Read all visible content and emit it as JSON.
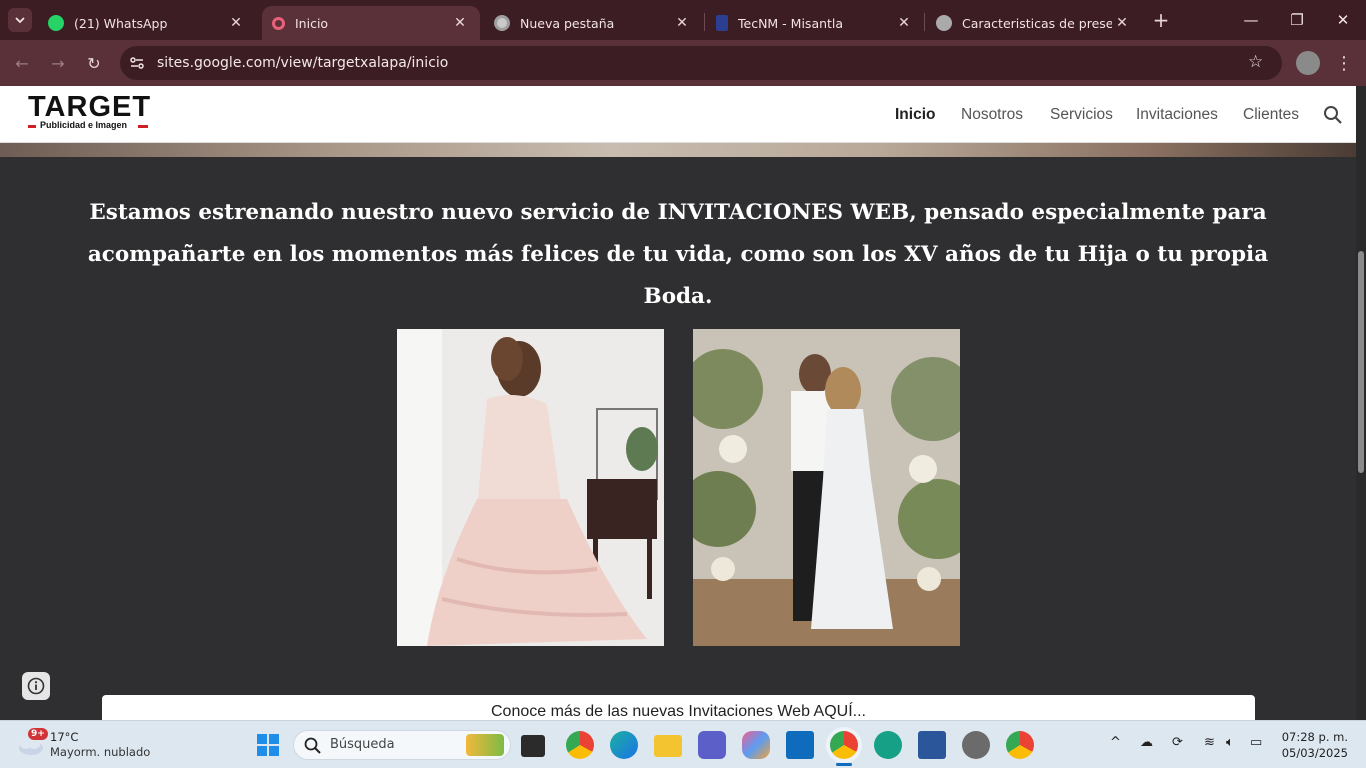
{
  "tabs": [
    {
      "title": "(21) WhatsApp",
      "icon": "whatsapp-icon",
      "color": "#25d366",
      "active": false
    },
    {
      "title": "Inicio",
      "icon": "google-sites-icon",
      "color": "#e8607a",
      "active": true
    },
    {
      "title": "Nueva pestaña",
      "icon": "chrome-icon",
      "color": "#bbbbbb",
      "active": false
    },
    {
      "title": "TecNM - Misantla",
      "icon": "tecnm-icon",
      "color": "#2c3e8f",
      "active": false
    },
    {
      "title": "Caracteristicas de presentación",
      "icon": "globe-icon",
      "color": "#bbbbbb",
      "active": false
    }
  ],
  "omnibox": {
    "url": "sites.google.com/view/targetxalapa/inicio"
  },
  "site": {
    "logo_text": "TARGET",
    "logo_sub": "Publicidad e Imagen",
    "nav": [
      "Inicio",
      "Nosotros",
      "Servicios",
      "Invitaciones",
      "Clientes"
    ],
    "nav_active": "Inicio",
    "lead_line1": "Estamos estrenando nuestro nuevo servicio de INVITACIONES WEB, pensado especialmente para",
    "lead_line2": "acompañarte en los momentos más felices de tu vida, como son los XV años de tu Hija o tu propia Boda.",
    "cta": "Conoce más de las nuevas Invitaciones Web AQUÍ..."
  },
  "taskbar": {
    "weather_temp": "17°C",
    "weather_desc": "Mayorm. nublado",
    "weather_badge": "9+",
    "search_placeholder": "Búsqueda",
    "time": "07:28 p. m.",
    "date": "05/03/2025"
  },
  "colors": {
    "tabstrip": "#3c1d24",
    "toolbar": "#5b3139",
    "page_bg": "#2f2e30",
    "logo_red": "#d11f2a"
  }
}
